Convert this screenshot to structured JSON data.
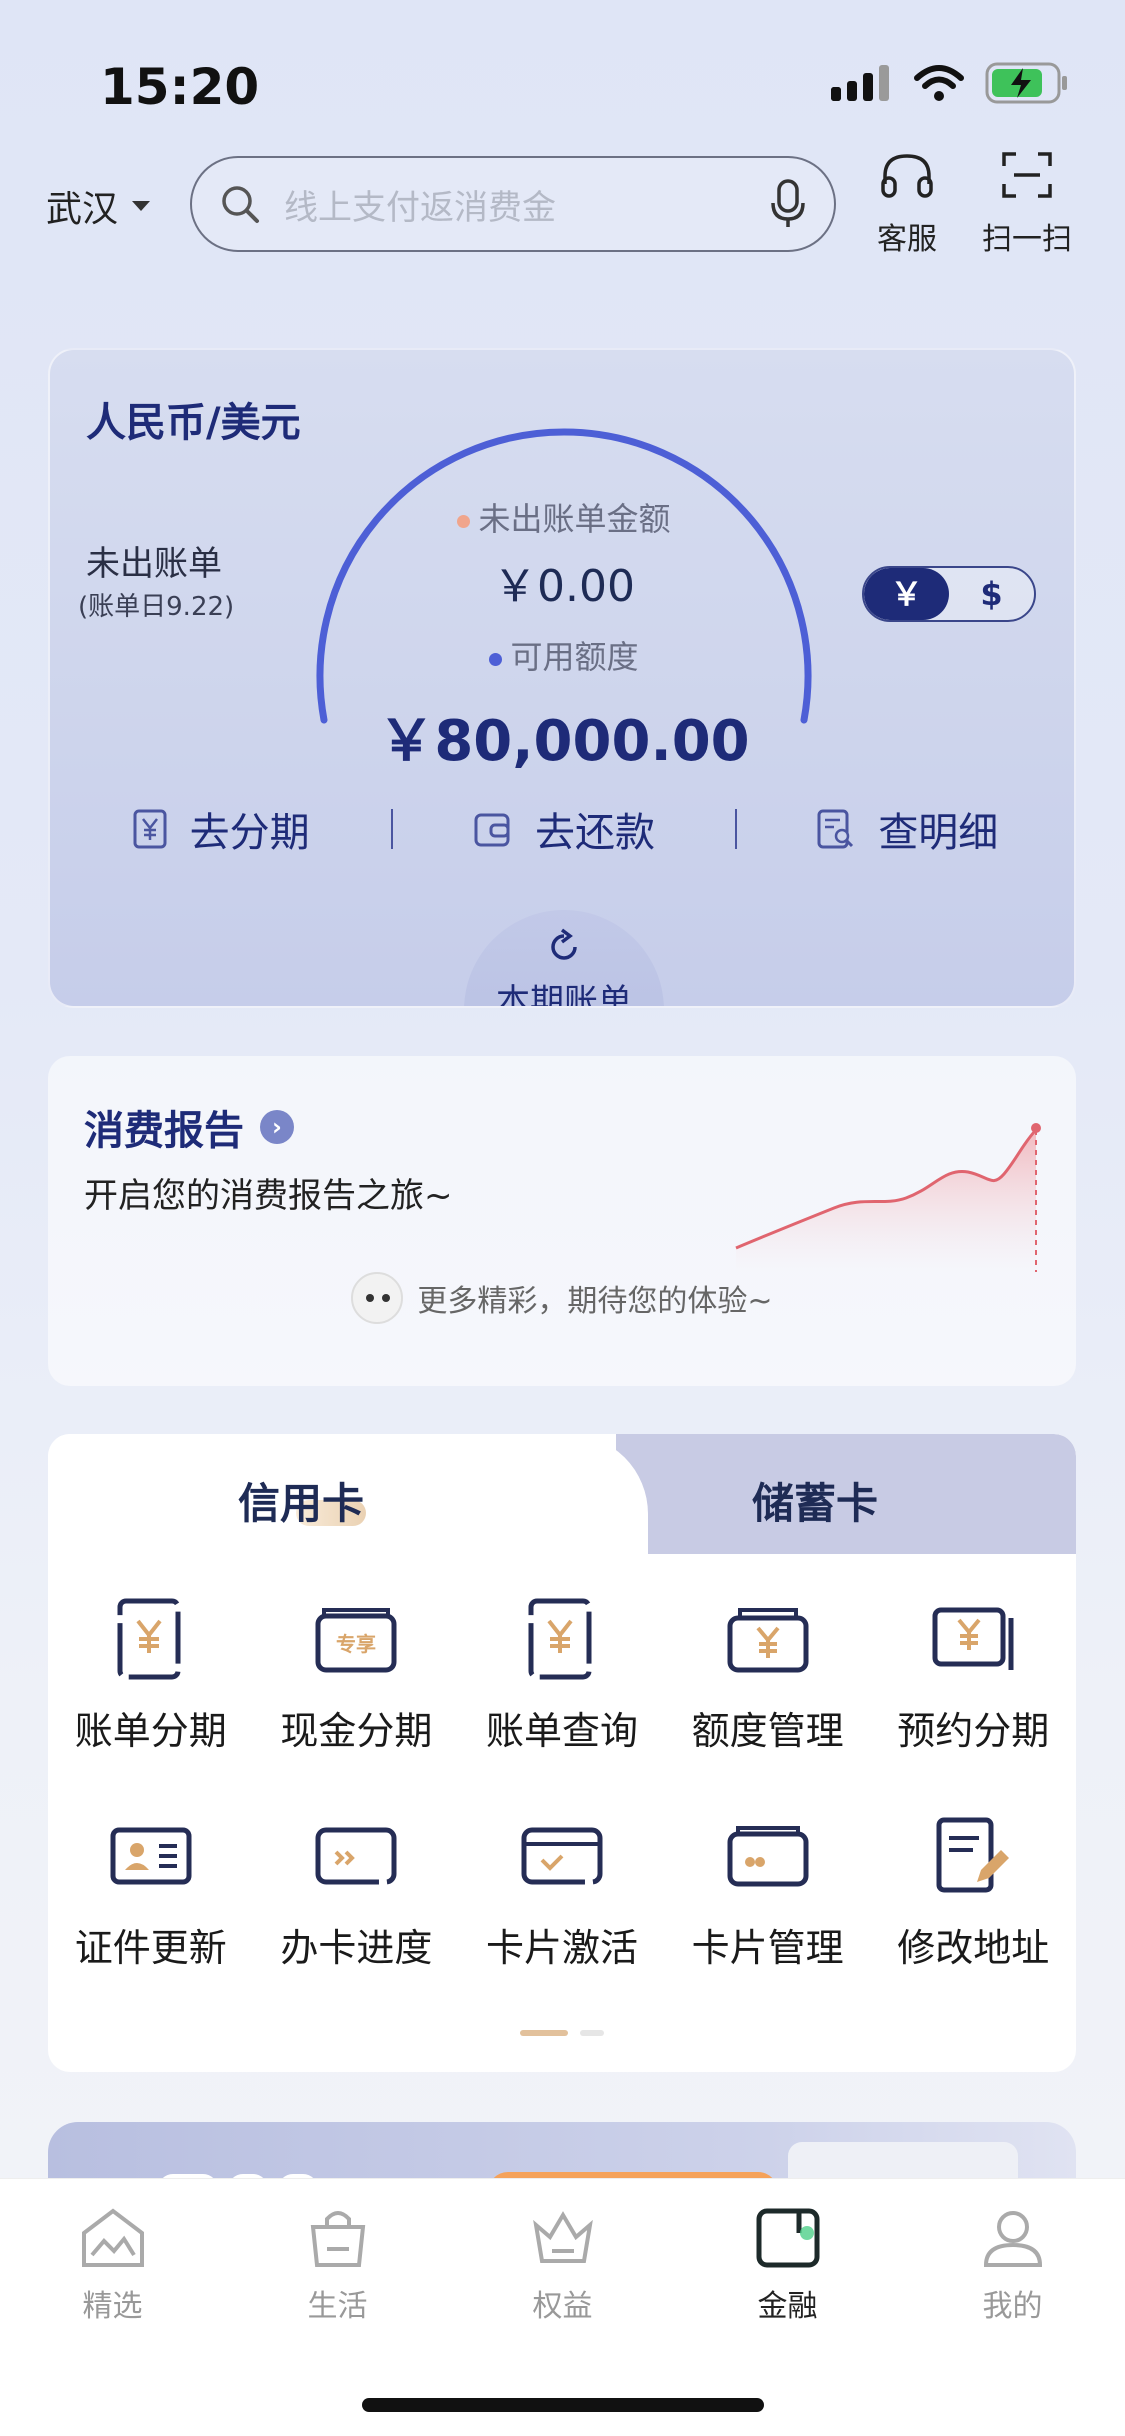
{
  "status_bar": {
    "time": "15:20"
  },
  "header": {
    "city": "武汉",
    "search_placeholder": "线上支付返消费金",
    "service_label": "客服",
    "scan_label": "扫一扫"
  },
  "bill_card": {
    "currency_title": "人民币/美元",
    "unbilled_label": "未出账单",
    "bill_date": "(账单日9.22)",
    "unbilled_amount_label": "未出账单金额",
    "unbilled_amount": "￥0.00",
    "available_label": "可用额度",
    "available_amount": "￥80,000.00",
    "currency_toggle": {
      "rmb": "￥",
      "usd": "$"
    },
    "actions": {
      "installment": "去分期",
      "repay": "去还款",
      "details": "查明细"
    },
    "current_bill_tab": "本期账单",
    "colors": {
      "arc": "#4d5fd6",
      "dot_unbilled": "#f0a58c",
      "dot_available": "#4d5fd6"
    }
  },
  "report": {
    "title": "消费报告",
    "subtitle": "开启您的消费报告之旅~",
    "more": "更多精彩，期待您的体验~"
  },
  "services": {
    "tab_credit": "信用卡",
    "tab_debit": "储蓄卡",
    "items": [
      {
        "label": "账单分期",
        "icon": "bill-installment-icon"
      },
      {
        "label": "现金分期",
        "icon": "cash-installment-icon"
      },
      {
        "label": "账单查询",
        "icon": "bill-query-icon"
      },
      {
        "label": "额度管理",
        "icon": "limit-management-icon"
      },
      {
        "label": "预约分期",
        "icon": "scheduled-installment-icon"
      },
      {
        "label": "证件更新",
        "icon": "id-update-icon"
      },
      {
        "label": "办卡进度",
        "icon": "card-progress-icon"
      },
      {
        "label": "卡片激活",
        "icon": "card-activate-icon"
      },
      {
        "label": "卡片管理",
        "icon": "card-management-icon"
      },
      {
        "label": "修改地址",
        "icon": "edit-address-icon"
      }
    ],
    "exclusive_badge": "专享"
  },
  "bottom_nav": {
    "items": [
      {
        "label": "精选",
        "icon": "featured-icon"
      },
      {
        "label": "生活",
        "icon": "life-icon"
      },
      {
        "label": "权益",
        "icon": "benefits-icon"
      },
      {
        "label": "金融",
        "icon": "finance-icon"
      },
      {
        "label": "我的",
        "icon": "profile-icon"
      }
    ],
    "active": "金融"
  }
}
